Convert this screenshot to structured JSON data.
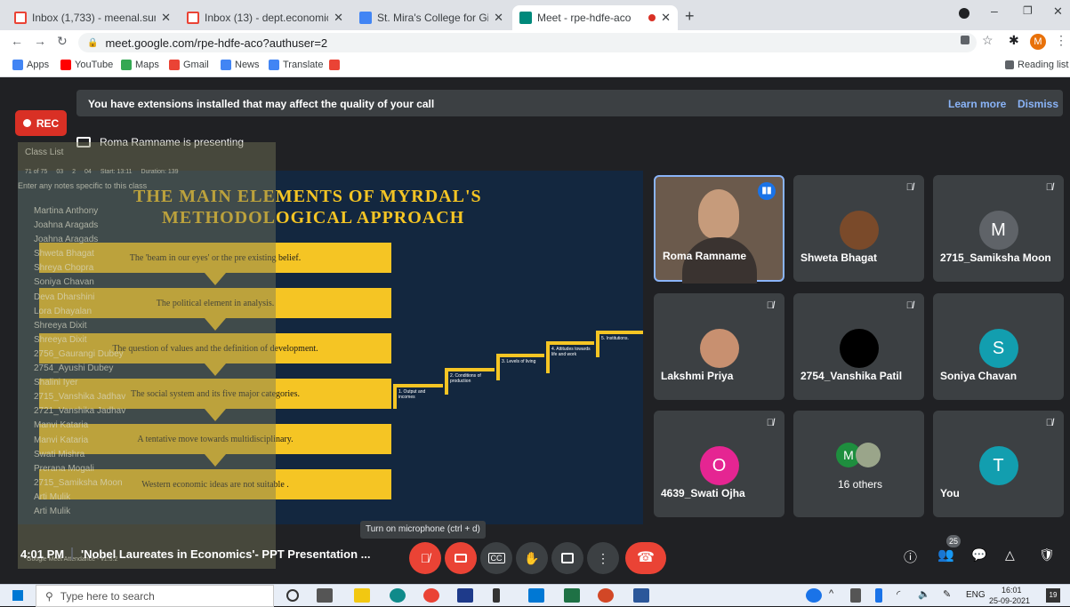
{
  "tabs": [
    {
      "title": "Inbox (1,733) - meenal.sumant@",
      "color": "#ea4335"
    },
    {
      "title": "Inbox (13) - dept.economics@st",
      "color": "#ea4335"
    },
    {
      "title": "St. Mira's College for Girls - Calen",
      "color": "#4285f4"
    },
    {
      "title": "Meet - rpe-hdfe-aco",
      "color": "#00897b"
    }
  ],
  "url": "meet.google.com/rpe-hdfe-aco?authuser=2",
  "profile_initial": "M",
  "bookmarks": [
    {
      "label": "Apps",
      "color": "#4285f4"
    },
    {
      "label": "YouTube",
      "color": "#ff0000"
    },
    {
      "label": "Maps",
      "color": "#34a853"
    },
    {
      "label": "Gmail",
      "color": "#ea4335"
    },
    {
      "label": "News",
      "color": "#4285f4"
    },
    {
      "label": "Translate",
      "color": "#4285f4"
    },
    {
      "label": "",
      "color": "#ea4335"
    }
  ],
  "reading_list": "Reading list",
  "extension_warning": {
    "message": "You have extensions installed that may affect the quality of your call",
    "learn_more": "Learn more",
    "dismiss": "Dismiss"
  },
  "rec_label": "REC",
  "presenting": "Roma Ramname is presenting",
  "slide": {
    "title_line1": "THE MAIN ELEMENTS OF MYRDAL'S",
    "title_line2": "METHODOLOGICAL APPROACH",
    "boxes": [
      "The 'beam in our eyes' or the pre existing belief.",
      "The political element in analysis.",
      "The question of values and the definition of development.",
      "The social system and its five major categories.",
      "A tentative move towards multidisciplinary.",
      "Western economic ideas are not suitable ."
    ],
    "steps": [
      "1. Output and incomes",
      "2. Conditions of production",
      "3. Levels of living",
      "4. Attitudes towards life and work",
      "5. Institutions."
    ]
  },
  "attendance_overlay": {
    "header": "Class List",
    "stats": [
      "71 of 75",
      "03",
      "2",
      "04",
      "Start: 13:11",
      "Duration: 139"
    ],
    "notes_placeholder": "Enter any notes specific to this class",
    "names": [
      "Martina Anthony",
      "Joahna Aragads",
      "Joahna Aragads",
      "Shweta Bhagat",
      "Shreya Chopra",
      "Soniya Chavan",
      "Deva Dharshini",
      "Lora Dhayalan",
      "Shreeya Dixit",
      "Shreeya Dixit",
      "2756_Gaurangi Dubey",
      "2754_Ayushi Dubey",
      "Shalini Iyer",
      "2715_Vanshika Jadhav",
      "2721_Vanshika Jadhav",
      "Manvi Kataria",
      "Manvi Kataria",
      "Swati Mishra",
      "Prerana Mogali",
      "2715_Samiksha Moon",
      "Arti Mulik",
      "Arti Mulik"
    ],
    "footer": "Google Meet Attendance - v1.5.2"
  },
  "tiles": [
    {
      "name": "Roma Ramname",
      "initial": "",
      "avatar_color": "#8a6f5a",
      "kind": "video"
    },
    {
      "name": "Shweta Bhagat",
      "initial": "",
      "avatar_color": "#7a4a2a",
      "kind": "photo"
    },
    {
      "name": "2715_Samiksha Moon",
      "initial": "M",
      "avatar_color": "#5f6368",
      "kind": "letter"
    },
    {
      "name": "Lakshmi Priya",
      "initial": "",
      "avatar_color": "#c89070",
      "kind": "photo"
    },
    {
      "name": "2754_Vanshika Patil",
      "initial": "",
      "avatar_color": "#000000",
      "kind": "photo"
    },
    {
      "name": "Soniya Chavan",
      "initial": "S",
      "avatar_color": "#129eaf",
      "kind": "letter"
    },
    {
      "name": "4639_Swati Ojha",
      "initial": "O",
      "avatar_color": "#e52592",
      "kind": "letter"
    },
    {
      "name": "16 others",
      "initial": "M",
      "avatar_color": "#1e8e3e",
      "kind": "others"
    },
    {
      "name": "You",
      "initial": "T",
      "avatar_color": "#129eaf",
      "kind": "letter"
    }
  ],
  "tooltip": "Turn on microphone (ctrl + d)",
  "meeting_time": "4:01 PM",
  "meeting_title": "'Nobel Laureates in Economics'- PPT Presentation ...",
  "participant_count": "25",
  "taskbar": {
    "search_placeholder": "Type here to search",
    "lang": "ENG",
    "time": "16:01",
    "date": "25-09-2021",
    "notif": "19"
  }
}
